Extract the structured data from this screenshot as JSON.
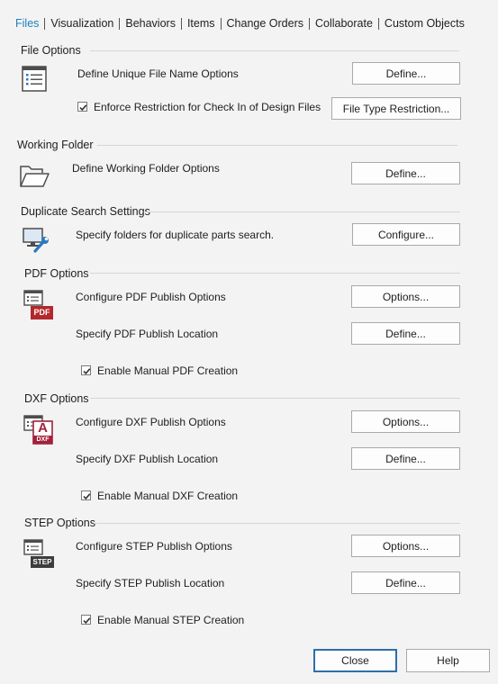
{
  "tabs": [
    {
      "label": "Files",
      "active": true
    },
    {
      "label": "Visualization"
    },
    {
      "label": "Behaviors"
    },
    {
      "label": "Items"
    },
    {
      "label": "Change Orders"
    },
    {
      "label": "Collaborate"
    },
    {
      "label": "Custom Objects"
    }
  ],
  "file_options": {
    "title": "File Options",
    "unique_name_label": "Define Unique File Name Options",
    "define_button": "Define...",
    "enforce_label": "Enforce Restriction for Check In of Design Files",
    "enforce_checked": true,
    "file_type_button": "File Type Restriction..."
  },
  "working_folder": {
    "title": "Working Folder",
    "label": "Define Working Folder Options",
    "define_button": "Define..."
  },
  "duplicate_search": {
    "title": "Duplicate Search Settings",
    "label": "Specify folders for duplicate parts search.",
    "configure_button": "Configure..."
  },
  "pdf": {
    "title": "PDF Options",
    "icon_text": "PDF",
    "configure_label": "Configure PDF Publish Options",
    "options_button": "Options...",
    "location_label": "Specify PDF Publish Location",
    "define_button": "Define...",
    "manual_label": "Enable Manual PDF Creation",
    "manual_checked": true
  },
  "dxf": {
    "title": "DXF Options",
    "icon_letter": "A",
    "icon_text": "DXF",
    "configure_label": "Configure DXF Publish Options",
    "options_button": "Options...",
    "location_label": "Specify DXF Publish Location",
    "define_button": "Define...",
    "manual_label": "Enable Manual DXF Creation",
    "manual_checked": true
  },
  "step": {
    "title": "STEP Options",
    "icon_text": "STEP",
    "configure_label": "Configure STEP Publish Options",
    "options_button": "Options...",
    "location_label": "Specify STEP Publish Location",
    "define_button": "Define...",
    "manual_label": "Enable Manual STEP Creation",
    "manual_checked": true
  },
  "footer": {
    "close_button": "Close",
    "help_button": "Help"
  },
  "colors": {
    "active_tab": "#1f7fc0",
    "pdf_red": "#b3282d",
    "dxf_red": "#a3203a",
    "step_dark": "#3d3d3d",
    "primary_border": "#2f6fa8"
  }
}
